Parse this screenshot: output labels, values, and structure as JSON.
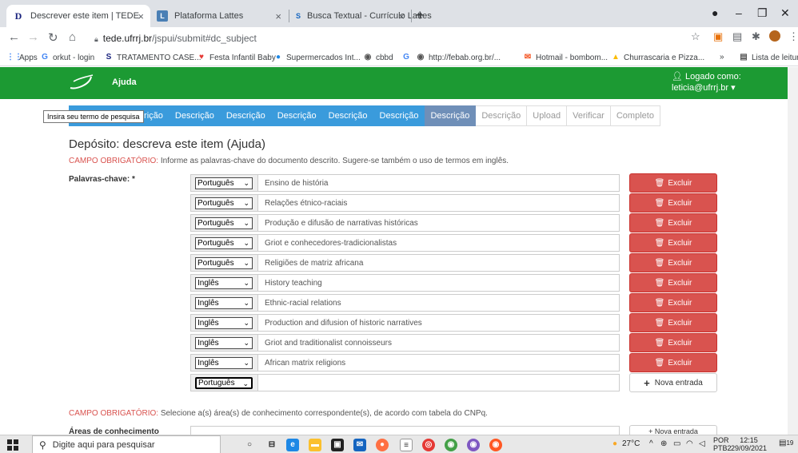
{
  "browser": {
    "tabs": [
      {
        "title": "Descrever este item | TEDE",
        "favicon": "D"
      },
      {
        "title": "Plataforma Lattes",
        "favicon": "L"
      },
      {
        "title": "Busca Textual - Currículo Lattes",
        "favicon": "S"
      }
    ],
    "url_host": "tede.ufrrj.br",
    "url_path": "/jspui/submit#dc_subject",
    "bookmarks": [
      "Apps",
      "orkut - login",
      "TRATAMENTO CASE...",
      "Festa Infantil Baby",
      "Supermercados Int...",
      "cbbd",
      "http://febab.org.br/...",
      "Hotmail - bombom...",
      "Churrascaria e Pizza...",
      "Lista de leitura"
    ]
  },
  "navbar": {
    "help_link": "Ajuda",
    "user_line1": "Logado como:",
    "user_line2": "leticia@ufrrj.br"
  },
  "tooltip": "Insira seu termo de pesquisa",
  "steps": {
    "first_partial": "a",
    "done": [
      "Descrição",
      "Descrição",
      "Descrição",
      "Descrição",
      "Descrição",
      "Descrição",
      "Descrição"
    ],
    "current": "Descrição",
    "todo": [
      "Descrição",
      "Upload",
      "Verificar",
      "Completo"
    ]
  },
  "form": {
    "title": "Depósito: descreva este item (Ajuda)",
    "required_label": "CAMPO OBRIGATÓRIO:",
    "keywords_hint": "Informe as palavras-chave do documento descrito. Sugere-se também o uso de termos em inglês.",
    "keywords_label": "Palavras-chave: *",
    "keywords": [
      {
        "lang": "Português",
        "value": "Ensino de história"
      },
      {
        "lang": "Português",
        "value": "Relações étnico-raciais"
      },
      {
        "lang": "Português",
        "value": "Produção e difusão de narrativas históricas"
      },
      {
        "lang": "Português",
        "value": "Griot e conhecedores-tradicionalistas"
      },
      {
        "lang": "Português",
        "value": "Religiões de matriz africana"
      },
      {
        "lang": "Inglês",
        "value": "History teaching"
      },
      {
        "lang": "Inglês",
        "value": "Ethnic-racial relations"
      },
      {
        "lang": "Inglês",
        "value": "Production and difusion of historic narratives"
      },
      {
        "lang": "Inglês",
        "value": "Griot and traditionalist connoisseurs"
      },
      {
        "lang": "Inglês",
        "value": "African matrix religions"
      },
      {
        "lang": "Português",
        "value": ""
      }
    ],
    "delete_label": "Excluir",
    "add_label": "Nova entrada",
    "areas_hint": "Selecione a(s) área(s) de conhecimento correspondente(s), de acordo com tabela do CNPq.",
    "areas_label": "Áreas de conhecimento"
  },
  "taskbar": {
    "search_placeholder": "Digite aqui para pesquisar",
    "temperature": "27°C",
    "lang1": "POR",
    "lang2": "PTB2",
    "time": "12:15",
    "date": "29/09/2021",
    "notifications": "19"
  },
  "colors": {
    "navbar_green": "#1c9a33",
    "step_done": "#3a9bdc",
    "step_current": "#6f8fb8",
    "danger": "#d9534f"
  }
}
